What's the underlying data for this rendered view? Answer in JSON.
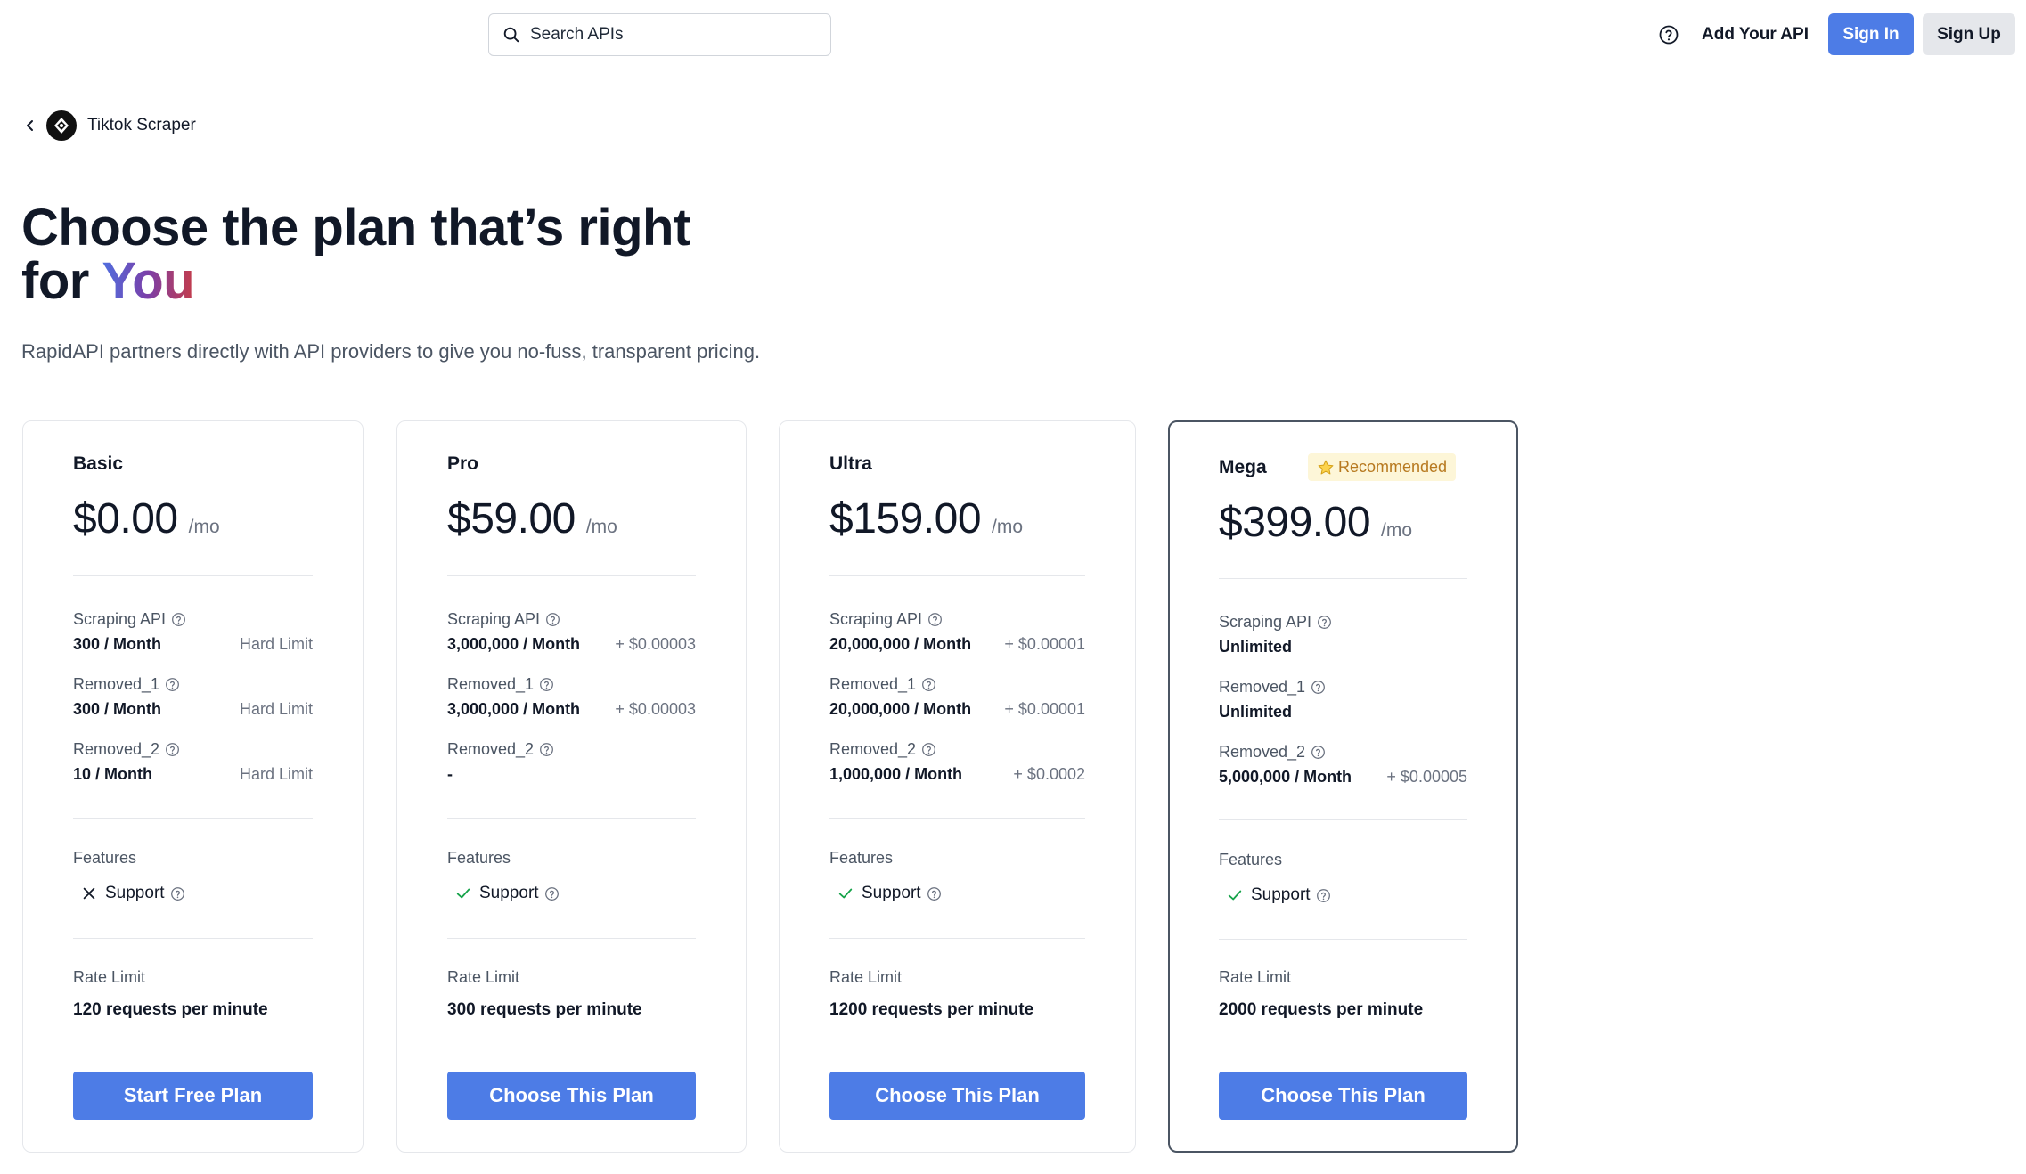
{
  "header": {
    "search_placeholder": "Search APIs",
    "help_icon": "question-circle-icon",
    "add_api_label": "Add Your API",
    "sign_in_label": "Sign In",
    "sign_up_label": "Sign Up"
  },
  "breadcrumb": {
    "api_name": "Tiktok Scraper"
  },
  "hero": {
    "title_line1": "Choose the plan that’s right",
    "title_for": "for",
    "title_you": "You",
    "subtitle": "RapidAPI partners directly with API providers to give you no-fuss, transparent pricing."
  },
  "colors": {
    "accent": "#4d7ce6",
    "check": "#16a34a",
    "recommended_bg": "#fdf6d8",
    "recommended_text": "#b7791f"
  },
  "plans": [
    {
      "name": "Basic",
      "price": "$0.00",
      "period": "/mo",
      "limits": [
        {
          "name": "Scraping API",
          "value": "300 / Month",
          "extra": "Hard Limit"
        },
        {
          "name": "Removed_1",
          "value": "300 / Month",
          "extra": "Hard Limit"
        },
        {
          "name": "Removed_2",
          "value": "10 / Month",
          "extra": "Hard Limit"
        }
      ],
      "features_label": "Features",
      "features": [
        {
          "name": "Support",
          "included": false
        }
      ],
      "rate_limit_label": "Rate Limit",
      "rate_limit": "120 requests per minute",
      "cta": "Start Free Plan"
    },
    {
      "name": "Pro",
      "price": "$59.00",
      "period": "/mo",
      "limits": [
        {
          "name": "Scraping API",
          "value": "3,000,000 / Month",
          "extra": "+ $0.00003"
        },
        {
          "name": "Removed_1",
          "value": "3,000,000 / Month",
          "extra": "+ $0.00003"
        },
        {
          "name": "Removed_2",
          "value": "-",
          "extra": ""
        }
      ],
      "features_label": "Features",
      "features": [
        {
          "name": "Support",
          "included": true
        }
      ],
      "rate_limit_label": "Rate Limit",
      "rate_limit": "300 requests per minute",
      "cta": "Choose This Plan"
    },
    {
      "name": "Ultra",
      "price": "$159.00",
      "period": "/mo",
      "limits": [
        {
          "name": "Scraping API",
          "value": "20,000,000 / Month",
          "extra": "+ $0.00001"
        },
        {
          "name": "Removed_1",
          "value": "20,000,000 / Month",
          "extra": "+ $0.00001"
        },
        {
          "name": "Removed_2",
          "value": "1,000,000 / Month",
          "extra": "+ $0.0002"
        }
      ],
      "features_label": "Features",
      "features": [
        {
          "name": "Support",
          "included": true
        }
      ],
      "rate_limit_label": "Rate Limit",
      "rate_limit": "1200 requests per minute",
      "cta": "Choose This Plan"
    },
    {
      "name": "Mega",
      "badge": "Recommended",
      "price": "$399.00",
      "period": "/mo",
      "limits": [
        {
          "name": "Scraping API",
          "value": "Unlimited",
          "extra": ""
        },
        {
          "name": "Removed_1",
          "value": "Unlimited",
          "extra": ""
        },
        {
          "name": "Removed_2",
          "value": "5,000,000 / Month",
          "extra": "+ $0.00005"
        }
      ],
      "features_label": "Features",
      "features": [
        {
          "name": "Support",
          "included": true
        }
      ],
      "rate_limit_label": "Rate Limit",
      "rate_limit": "2000 requests per minute",
      "cta": "Choose This Plan"
    }
  ]
}
